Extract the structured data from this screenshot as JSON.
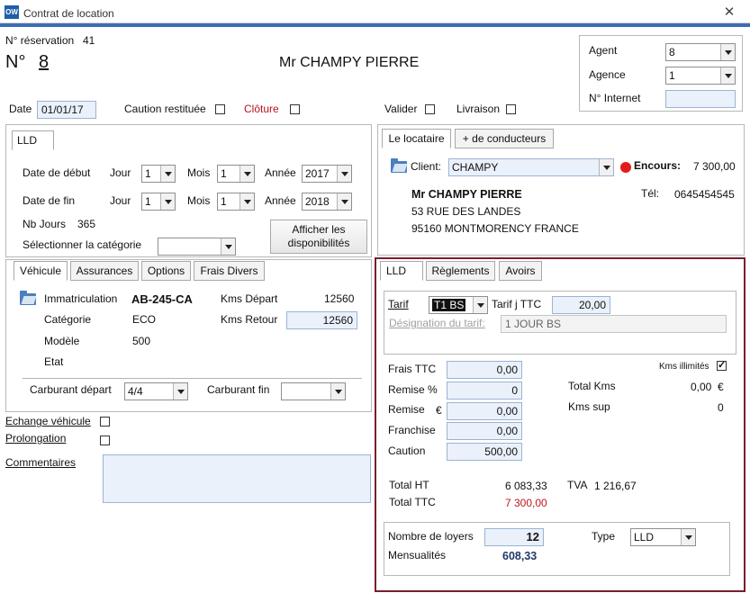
{
  "window": {
    "title": "Contrat de location",
    "app_icon": "OW"
  },
  "header": {
    "reservation_label": "N° réservation",
    "reservation_value": "41",
    "no_label": "N°",
    "no_value": "8",
    "client_name": "Mr CHAMPY  PIERRE"
  },
  "agent_panel": {
    "agent_label": "Agent",
    "agent_value": "8",
    "agence_label": "Agence",
    "agence_value": "1",
    "internet_label": "N° Internet",
    "internet_value": ""
  },
  "date_row": {
    "date_label": "Date",
    "date_value": "01/01/17",
    "caution_label": "Caution restituée",
    "cloture_label": "Clôture",
    "valider_label": "Valider",
    "livraison_label": "Livraison"
  },
  "lld_panel": {
    "tab": "LLD",
    "debut_label": "Date de début",
    "fin_label": "Date de fin",
    "jour_label": "Jour",
    "mois_label": "Mois",
    "annee_label": "Année",
    "debut_jour": "1",
    "debut_mois": "1",
    "debut_annee": "2017",
    "fin_jour": "1",
    "fin_mois": "1",
    "fin_annee": "2018",
    "nb_jours_label": "Nb Jours",
    "nb_jours_value": "365",
    "categorie_label": "Sélectionner la catégorie",
    "categorie_value": "",
    "dispo_button_line1": "Afficher les",
    "dispo_button_line2": "disponibilités"
  },
  "vehicle_tabs": [
    "Véhicule",
    "Assurances",
    "Options",
    "Frais Divers"
  ],
  "vehicle": {
    "immat_label": "Immatriculation",
    "immat_value": "AB-245-CA",
    "categorie_label": "Catégorie",
    "categorie_value": "ECO",
    "modele_label": "Modèle",
    "modele_value": "500",
    "etat_label": "Etat",
    "kms_depart_label": "Kms Départ",
    "kms_depart_value": "12560",
    "kms_retour_label": "Kms Retour",
    "kms_retour_value": "12560",
    "carburant_depart_label": "Carburant départ",
    "carburant_depart_value": "4/4",
    "carburant_fin_label": "Carburant fin",
    "carburant_fin_value": ""
  },
  "left_bottom": {
    "echange_label": "Echange véhicule",
    "prolongation_label": "Prolongation",
    "commentaires_label": "Commentaires",
    "commentaires_value": ""
  },
  "locataire_tabs": [
    "Le locataire",
    "+ de conducteurs"
  ],
  "locataire": {
    "client_label": "Client:",
    "client_value": "CHAMPY",
    "encours_label": "Encours:",
    "encours_value": "7 300,00",
    "name": "Mr CHAMPY PIERRE",
    "tel_label": "Tél:",
    "tel_value": "0645454545",
    "address1": "53 RUE DES LANDES",
    "address2": "95160 MONTMORENCY FRANCE"
  },
  "billing_tabs": [
    "LLD",
    "Règlements",
    "Avoirs"
  ],
  "billing": {
    "tarif_label": "Tarif",
    "tarif_value": "T1 BS",
    "tarif_j_label": "Tarif j TTC",
    "tarif_j_value": "20,00",
    "designation_label": "Désignation du tarif:",
    "designation_value": "1 JOUR BS",
    "frais_label": "Frais TTC",
    "frais_value": "0,00",
    "remise_pct_label": "Remise %",
    "remise_pct_value": "0",
    "remise_eur_label": "Remise",
    "remise_eur_symbol": "€",
    "remise_eur_value": "0,00",
    "franchise_label": "Franchise",
    "franchise_value": "0,00",
    "caution_label": "Caution",
    "caution_value": "500,00",
    "kms_illimites_label": "Kms illimités",
    "total_kms_label": "Total Kms",
    "total_kms_value": "0,00",
    "total_kms_unit": "€",
    "kms_sup_label": "Kms sup",
    "kms_sup_value": "0",
    "total_ht_label": "Total HT",
    "total_ht_value": "6 083,33",
    "tva_label": "TVA",
    "tva_value": "1 216,67",
    "total_ttc_label": "Total TTC",
    "total_ttc_value": "7 300,00",
    "loyers_label": "Nombre de loyers",
    "loyers_value": "12",
    "type_label": "Type",
    "type_value": "LLD",
    "mensualites_label": "Mensualités",
    "mensualites_value": "608,33"
  },
  "colors": {
    "accent": "#3b6db4",
    "highlight_border": "#7a1f2b",
    "red_text": "#c0141c",
    "dark_blue": "#1f3a66"
  }
}
